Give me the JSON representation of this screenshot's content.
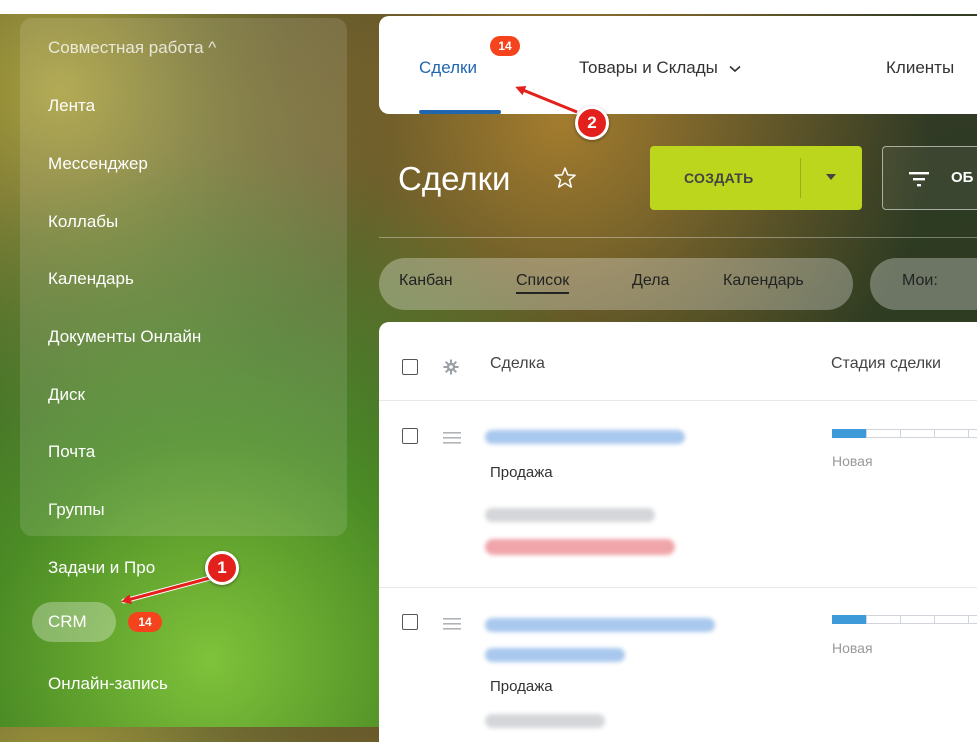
{
  "sidebar": {
    "header": "Совместная работа ^",
    "group_items": [
      "Лента",
      "Мессенджер",
      "Коллабы",
      "Календарь",
      "Документы Онлайн",
      "Диск",
      "Почта",
      "Группы"
    ],
    "tasks_label": "Задачи и Про",
    "crm_label": "CRM",
    "crm_badge": "14",
    "online_booking_label": "Онлайн-запись"
  },
  "top_tabs": {
    "deals": "Сделки",
    "deals_badge": "14",
    "goods": "Товары и Склады",
    "clients": "Клиенты"
  },
  "page": {
    "title": "Сделки",
    "create_button": "СОЗДАТЬ",
    "filter_partial": "ОБ"
  },
  "view_switcher": {
    "items": [
      "Канбан",
      "Список",
      "Дела",
      "Календарь"
    ],
    "active": "Список",
    "mine_label": "Мои:"
  },
  "grid": {
    "columns": [
      "Сделка",
      "Стадия сделки"
    ],
    "rows": [
      {
        "category": "Продажа",
        "stage": "Новая",
        "stage_progress": 0.2
      },
      {
        "category": "Продажа",
        "stage": "Новая",
        "stage_progress": 0.2
      }
    ]
  },
  "annotations": [
    "1",
    "2"
  ],
  "colors": {
    "accent_blue": "#2067b0",
    "create_green": "#bbd61d",
    "badge_red": "#f5441d",
    "callout_red": "#e3201b",
    "stage_blue": "#3e9ad8"
  }
}
